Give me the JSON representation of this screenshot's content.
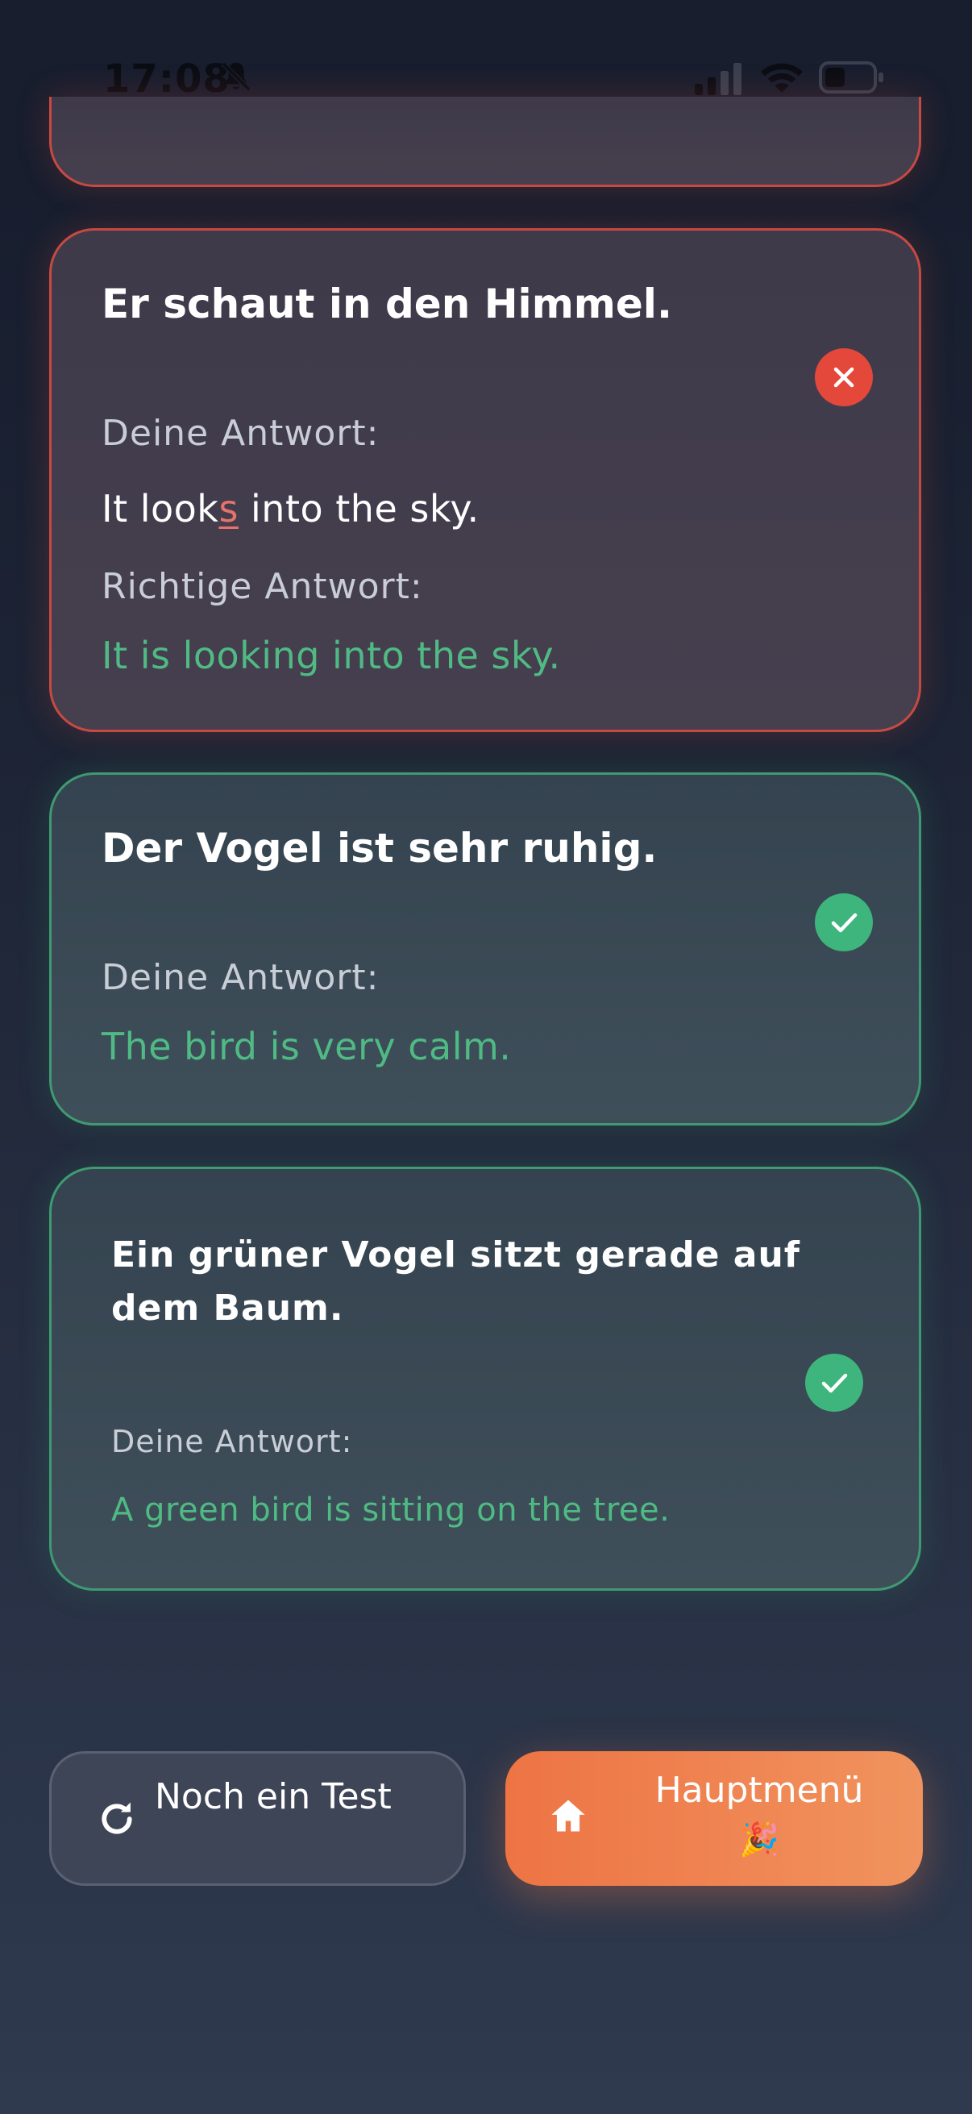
{
  "status_bar": {
    "time": "17:08",
    "icons": [
      "bell-slash-icon",
      "signal-icon",
      "wifi-icon",
      "battery-icon"
    ]
  },
  "results": [
    {
      "status": "wrong",
      "sentence": "Er schaut in den Himmel.",
      "your_answer_label": "Deine Antwort:",
      "your_answer_before": "It look",
      "your_answer_error": "s",
      "your_answer_after": " into the sky.",
      "correct_answer_label": "Richtige Antwort:",
      "correct_answer": "It is looking into the sky.",
      "icon": "close-icon"
    },
    {
      "status": "correct",
      "sentence": "Der Vogel ist sehr ruhig.",
      "your_answer_label": "Deine Antwort:",
      "your_answer": "The bird is very calm.",
      "icon": "check-icon"
    },
    {
      "status": "correct",
      "sentence": "Ein grüner Vogel sitzt gerade auf dem Baum.",
      "your_answer_label": "Deine Antwort:",
      "your_answer": "A green bird is sitting on the tree.",
      "icon": "check-icon"
    }
  ],
  "buttons": {
    "retry_label": "Noch ein Test",
    "retry_icon": "refresh-icon",
    "home_label": "Hauptmenü",
    "home_emoji": "🎉",
    "home_icon": "home-icon"
  },
  "colors": {
    "wrong_border": "#c64a42",
    "correct_border": "#3f9a72",
    "correct_text": "#4fba84",
    "error_text": "#e4736b",
    "accent_orange": "#ee7444"
  }
}
